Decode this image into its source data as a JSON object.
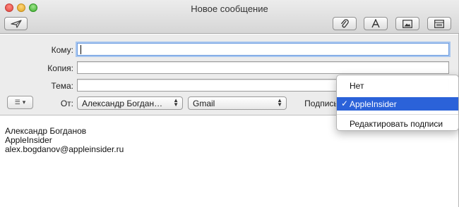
{
  "window": {
    "title": "Новое сообщение"
  },
  "header": {
    "to_label": "Кому:",
    "to_value": "",
    "cc_label": "Копия:",
    "cc_value": "",
    "subject_label": "Тема:",
    "subject_value": "",
    "from_label": "От:",
    "from_value": "Александр Богдан…",
    "account_value": "Gmail",
    "signature_label": "Подпись:"
  },
  "signature_menu": {
    "items": [
      {
        "label": "Нет",
        "selected": false
      },
      {
        "label": "AppleInsider",
        "selected": true
      },
      {
        "label": "Редактировать подписи",
        "selected": false
      }
    ]
  },
  "body": {
    "lines": [
      "Александр Богданов",
      "AppleInsider",
      "alex.bogdanov@appleinsider.ru"
    ]
  },
  "icons": [
    "send-icon",
    "attach-icon",
    "font-icon",
    "photo-browser-icon",
    "stationery-icon",
    "list-icon",
    "chevron-down-icon",
    "checkmark-icon"
  ],
  "colors": {
    "selection": "#2b62d9",
    "focus_ring": "#a8c6ef"
  }
}
